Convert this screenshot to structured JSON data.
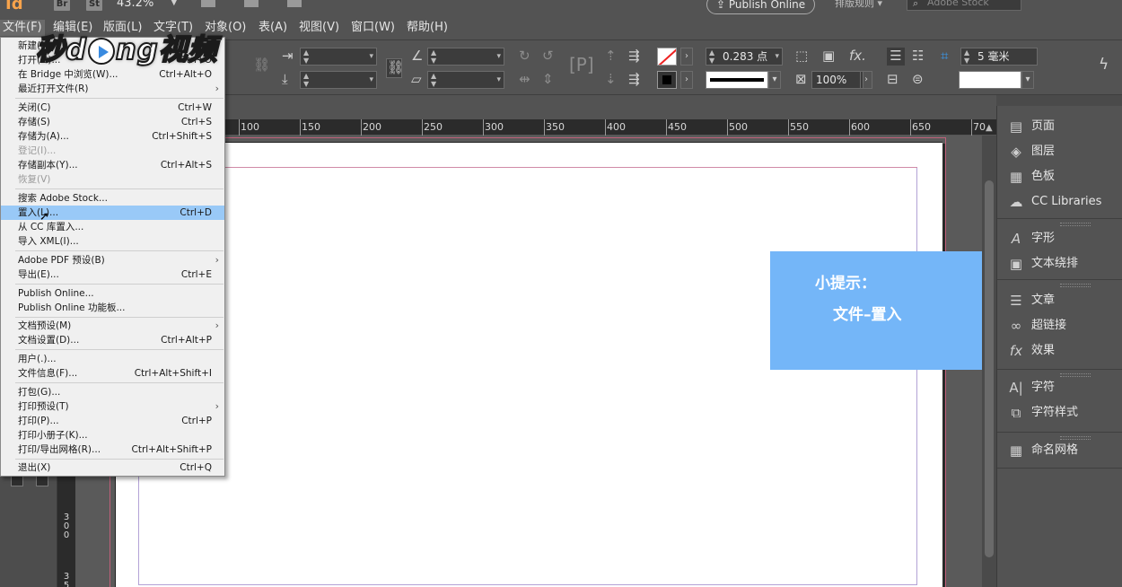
{
  "appbar": {
    "zoom": "43.2%",
    "publish_online": "Publish Online",
    "workspace": "排版规则",
    "stock_placeholder": "Adobe Stock",
    "br": "Br",
    "st": "St"
  },
  "menubar": {
    "items": [
      "文件(F)",
      "编辑(E)",
      "版面(L)",
      "文字(T)",
      "对象(O)",
      "表(A)",
      "视图(V)",
      "窗口(W)",
      "帮助(H)"
    ],
    "active_index": 0
  },
  "control": {
    "stroke_weight": "0.283 点",
    "opacity": "100%",
    "spacing": "5 毫米"
  },
  "ruler": {
    "labels": [
      "100",
      "150",
      "200",
      "250",
      "300",
      "350",
      "400",
      "450",
      "500",
      "550",
      "600",
      "650",
      "70"
    ],
    "vertical": [
      "3",
      "0",
      "0",
      "3",
      "5"
    ]
  },
  "file_menu": {
    "items": [
      {
        "label": "新建(N)",
        "shortcut": "",
        "submenu": true,
        "disabled": false
      },
      {
        "label": "打开(O)...",
        "shortcut": "Ctrl+O",
        "submenu": false,
        "disabled": false
      },
      {
        "label": "在 Bridge 中浏览(W)...",
        "shortcut": "Ctrl+Alt+O",
        "submenu": false,
        "disabled": false
      },
      {
        "label": "最近打开文件(R)",
        "shortcut": "",
        "submenu": true,
        "disabled": false
      },
      {
        "label": "关闭(C)",
        "shortcut": "Ctrl+W",
        "submenu": false,
        "disabled": false
      },
      {
        "label": "存储(S)",
        "shortcut": "Ctrl+S",
        "submenu": false,
        "disabled": false
      },
      {
        "label": "存储为(A)...",
        "shortcut": "Ctrl+Shift+S",
        "submenu": false,
        "disabled": false
      },
      {
        "label": "登记(I)...",
        "shortcut": "",
        "submenu": false,
        "disabled": true
      },
      {
        "label": "存储副本(Y)...",
        "shortcut": "Ctrl+Alt+S",
        "submenu": false,
        "disabled": false
      },
      {
        "label": "恢复(V)",
        "shortcut": "",
        "submenu": false,
        "disabled": true
      },
      {
        "label": "搜索 Adobe Stock...",
        "shortcut": "",
        "submenu": false,
        "disabled": false
      },
      {
        "label": "置入(L)...",
        "shortcut": "Ctrl+D",
        "submenu": false,
        "disabled": false,
        "highlighted": true
      },
      {
        "label": "从 CC 库置入...",
        "shortcut": "",
        "submenu": false,
        "disabled": false
      },
      {
        "label": "导入 XML(I)...",
        "shortcut": "",
        "submenu": false,
        "disabled": false
      },
      {
        "label": "Adobe PDF 预设(B)",
        "shortcut": "",
        "submenu": true,
        "disabled": false
      },
      {
        "label": "导出(E)...",
        "shortcut": "Ctrl+E",
        "submenu": false,
        "disabled": false
      },
      {
        "label": "Publish Online...",
        "shortcut": "",
        "submenu": false,
        "disabled": false
      },
      {
        "label": "Publish Online 功能板...",
        "shortcut": "",
        "submenu": false,
        "disabled": false
      },
      {
        "label": "文档预设(M)",
        "shortcut": "",
        "submenu": true,
        "disabled": false
      },
      {
        "label": "文档设置(D)...",
        "shortcut": "Ctrl+Alt+P",
        "submenu": false,
        "disabled": false
      },
      {
        "label": "用户(.)...",
        "shortcut": "",
        "submenu": false,
        "disabled": false
      },
      {
        "label": "文件信息(F)...",
        "shortcut": "Ctrl+Alt+Shift+I",
        "submenu": false,
        "disabled": false
      },
      {
        "label": "打包(G)...",
        "shortcut": "",
        "submenu": false,
        "disabled": false
      },
      {
        "label": "打印预设(T)",
        "shortcut": "",
        "submenu": true,
        "disabled": false
      },
      {
        "label": "打印(P)...",
        "shortcut": "Ctrl+P",
        "submenu": false,
        "disabled": false
      },
      {
        "label": "打印小册子(K)...",
        "shortcut": "",
        "submenu": false,
        "disabled": false
      },
      {
        "label": "打印/导出网格(R)...",
        "shortcut": "Ctrl+Alt+Shift+P",
        "submenu": false,
        "disabled": false
      },
      {
        "label": "退出(X)",
        "shortcut": "Ctrl+Q",
        "submenu": false,
        "disabled": false
      }
    ]
  },
  "tip": {
    "line1": "小提示：",
    "line2": "文件–置入"
  },
  "panels": {
    "items": [
      {
        "label": "页面",
        "icon": "pages-icon"
      },
      {
        "label": "图层",
        "icon": "layers-icon"
      },
      {
        "label": "色板",
        "icon": "swatches-icon"
      },
      {
        "label": "CC Libraries",
        "icon": "cc-libraries-icon"
      },
      {
        "label": "字形",
        "icon": "glyphs-icon"
      },
      {
        "label": "文本绕排",
        "icon": "text-wrap-icon"
      },
      {
        "label": "文章",
        "icon": "story-icon"
      },
      {
        "label": "超链接",
        "icon": "hyperlink-icon"
      },
      {
        "label": "效果",
        "icon": "effects-icon"
      },
      {
        "label": "字符",
        "icon": "character-icon"
      },
      {
        "label": "字符样式",
        "icon": "character-styles-icon"
      },
      {
        "label": "命名网格",
        "icon": "named-grid-icon"
      }
    ]
  },
  "watermark": {
    "text_a": "秒d",
    "text_b": "ng视频"
  },
  "colors": {
    "menu_highlight": "#99c9f7",
    "tip_bg": "#74b6f8",
    "ui_bg": "#535353"
  }
}
